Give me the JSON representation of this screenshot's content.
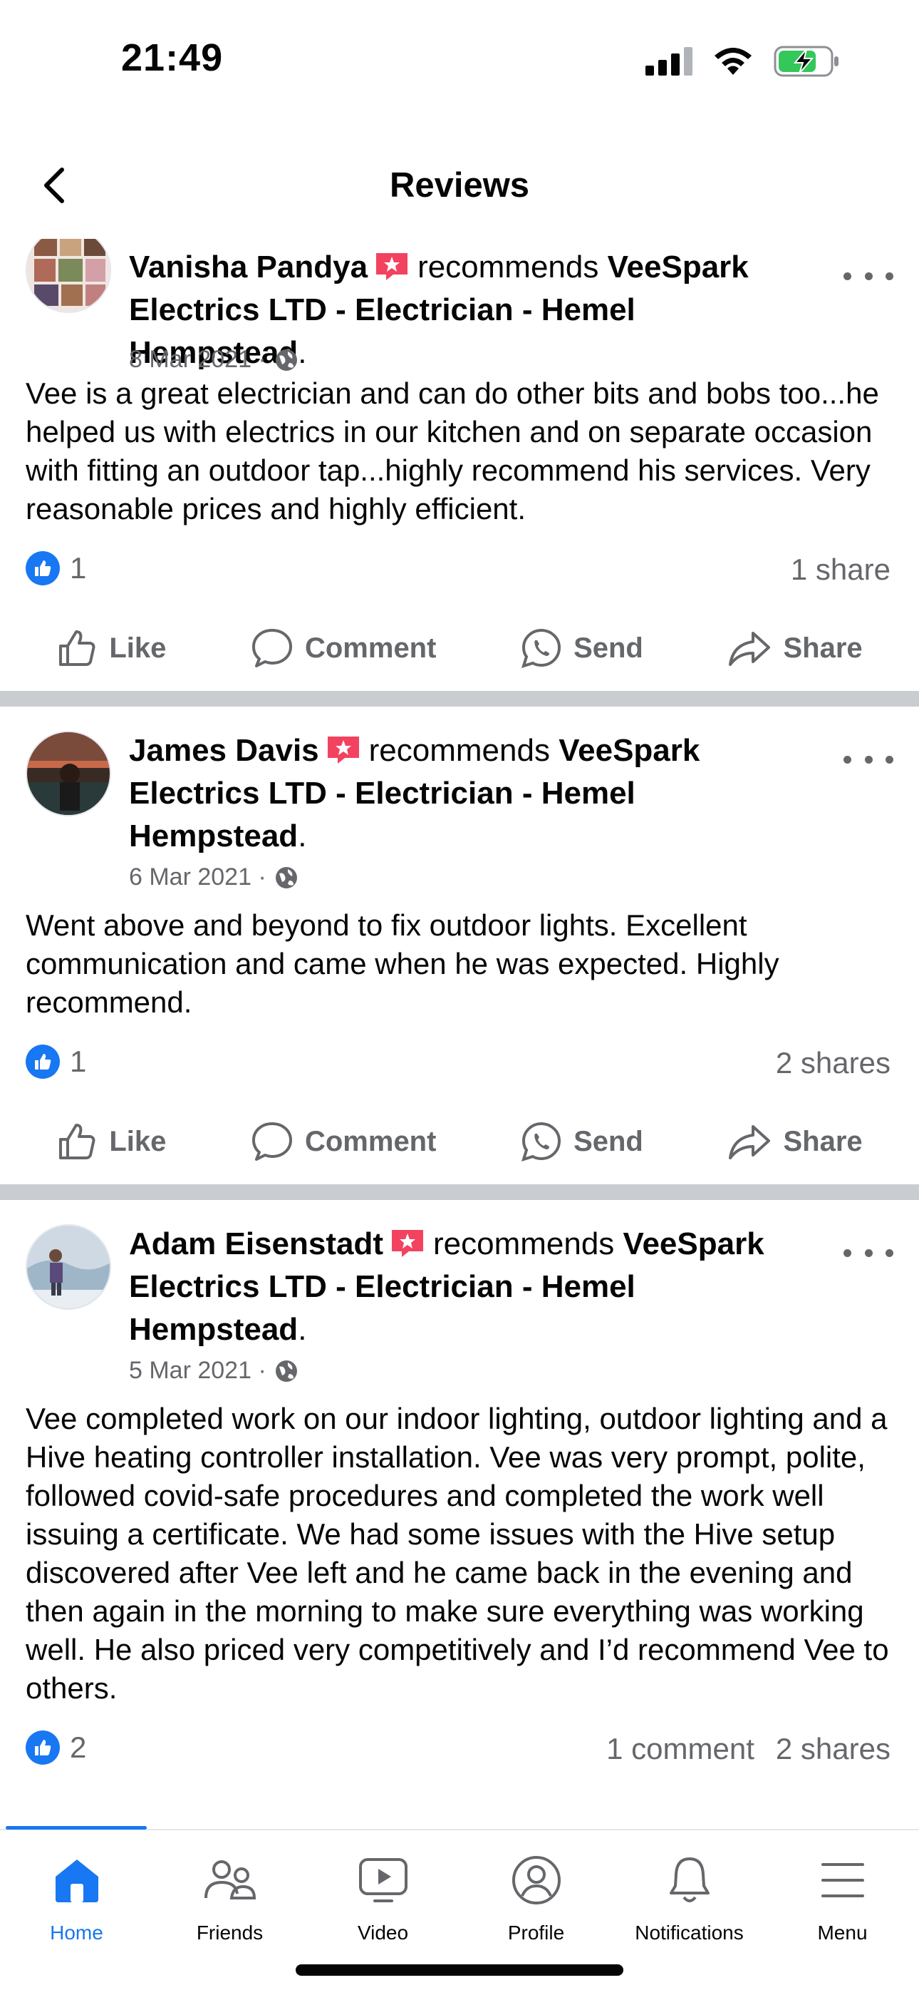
{
  "status_bar": {
    "time": "21:49",
    "battery_charging": true
  },
  "nav": {
    "title": "Reviews",
    "back_icon": "chevron-left-icon"
  },
  "colors": {
    "accent": "#1877f2",
    "badge": "#f3425f",
    "muted": "#65676b",
    "divider": "#c9ccd1"
  },
  "posts": [
    {
      "author": "Vanisha Pandya",
      "recommends_label": "recommends",
      "page_name": "VeeSpark Electrics LTD -  Electrician - Hemel Hempstead",
      "page_suffix": ".",
      "date": "8 Mar 2021 ·",
      "text": "Vee is a great electrician and can do other bits and bobs too...he helped us with electrics in our kitchen and on separate occasion with fitting an outdoor tap...highly recommend his services. Very reasonable prices and highly efficient.",
      "likes": "1",
      "comments": "",
      "shares": "1 share"
    },
    {
      "author": "James Davis",
      "recommends_label": "recommends",
      "page_name": "VeeSpark Electrics LTD -  Electrician - Hemel Hempstead",
      "page_suffix": ".",
      "date": "6 Mar 2021 ·",
      "text": "Went above and beyond to fix outdoor lights. Excellent communication and came when he was expected. Highly recommend.",
      "likes": "1",
      "comments": "",
      "shares": "2 shares"
    },
    {
      "author": "Adam Eisenstadt",
      "recommends_label": "recommends",
      "page_name": "VeeSpark Electrics LTD -  Electrician - Hemel Hempstead",
      "page_suffix": ".",
      "date": "5 Mar 2021 ·",
      "text": "Vee completed work on our indoor lighting, outdoor lighting and a Hive heating controller installation. Vee was very prompt, polite, followed covid-safe procedures and completed the work well issuing a certificate. We had some issues with the Hive setup discovered after Vee left and he came back in the evening and then again in the morning to make sure everything was working well. He also priced very competitively and I’d recommend Vee to others.",
      "likes": "2",
      "comments": "1 comment",
      "shares": "2 shares"
    }
  ],
  "actions": {
    "like": "Like",
    "comment": "Comment",
    "send": "Send",
    "share": "Share"
  },
  "tabs": [
    {
      "label": "Home",
      "icon": "home-icon",
      "active": true
    },
    {
      "label": "Friends",
      "icon": "friends-icon",
      "active": false
    },
    {
      "label": "Video",
      "icon": "video-icon",
      "active": false
    },
    {
      "label": "Profile",
      "icon": "profile-icon",
      "active": false
    },
    {
      "label": "Notifications",
      "icon": "bell-icon",
      "active": false
    },
    {
      "label": "Menu",
      "icon": "menu-icon",
      "active": false
    }
  ]
}
